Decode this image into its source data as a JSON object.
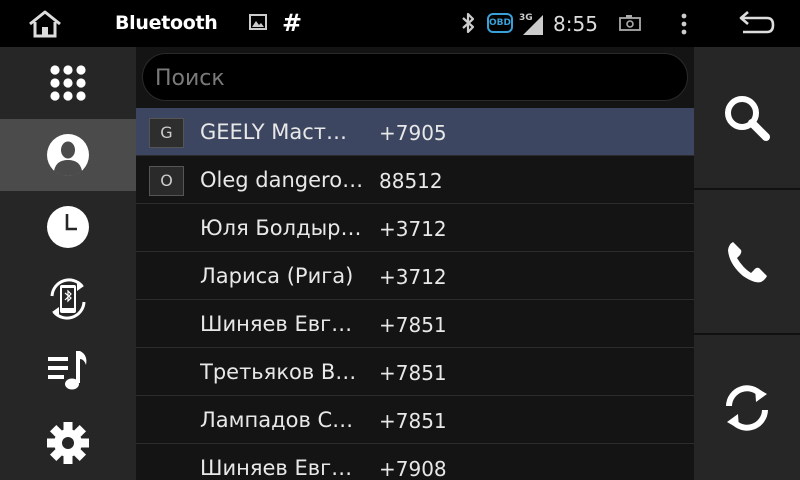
{
  "statusbar": {
    "title": "Bluetooth",
    "hash": "#",
    "obd": "OBD",
    "network": "3G",
    "time": "8:55"
  },
  "nav": {
    "items": [
      {
        "icon": "apps-grid-icon",
        "active": false
      },
      {
        "icon": "contacts-icon",
        "active": true
      },
      {
        "icon": "recent-calls-icon",
        "active": false
      },
      {
        "icon": "phone-sync-icon",
        "active": false
      },
      {
        "icon": "music-icon",
        "active": false
      },
      {
        "icon": "settings-icon",
        "active": false
      }
    ]
  },
  "search": {
    "placeholder": "Поиск",
    "value": ""
  },
  "contacts": [
    {
      "badge": "G",
      "name": "GEELY Маст…",
      "phone": "+7905",
      "selected": true
    },
    {
      "badge": "O",
      "name": "Oleg dangero…",
      "phone": "88512",
      "selected": false
    },
    {
      "badge": "",
      "name": "Юля Болдыр…",
      "phone": "+3712",
      "selected": false
    },
    {
      "badge": "",
      "name": "Лариса (Рига)",
      "phone": "+3712",
      "selected": false
    },
    {
      "badge": "",
      "name": "Шиняев Евг…",
      "phone": "+7851",
      "selected": false
    },
    {
      "badge": "",
      "name": "Третьяков В…",
      "phone": "+7851",
      "selected": false
    },
    {
      "badge": "",
      "name": "Лампадов С…",
      "phone": "+7851",
      "selected": false
    },
    {
      "badge": "",
      "name": "Шиняев Евг…",
      "phone": "+7908",
      "selected": false
    }
  ],
  "actions": [
    "search-icon",
    "call-icon",
    "refresh-icon"
  ],
  "colors": {
    "selected_row": "#3c4660",
    "panel": "#262626",
    "active_nav": "#4b4b4b",
    "obd_blue": "#3aa0d8"
  }
}
